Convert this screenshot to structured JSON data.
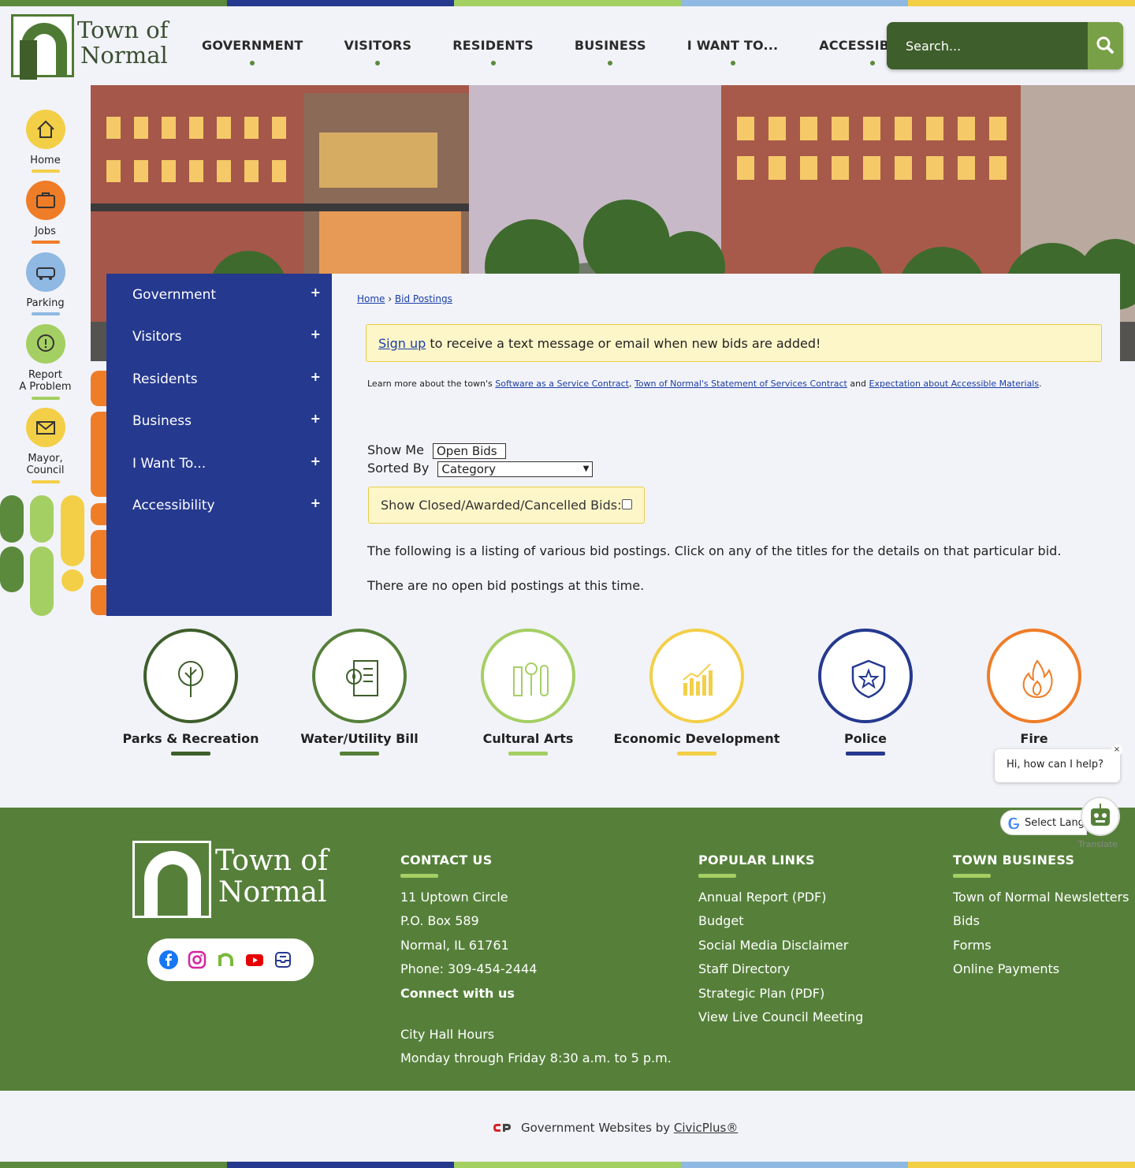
{
  "brand": {
    "line1": "Town of",
    "line2": "Normal",
    "stripe_colors": [
      "#5b8a3c",
      "#25398f",
      "#a4cf63",
      "#8fb8e2",
      "#f3cf48"
    ]
  },
  "nav": {
    "items": [
      "GOVERNMENT",
      "VISITORS",
      "RESIDENTS",
      "BUSINESS",
      "I WANT TO...",
      "ACCESSIBILITY"
    ]
  },
  "search": {
    "placeholder": "Search..."
  },
  "quicklinks": [
    {
      "label": "Home",
      "icon": "home-icon",
      "color": "#f3cf48"
    },
    {
      "label": "Jobs",
      "icon": "briefcase-icon",
      "color": "#ef7d28"
    },
    {
      "label": "Parking",
      "icon": "car-icon",
      "color": "#8fb8e2"
    },
    {
      "label": "Report\nA Problem",
      "icon": "alert-icon",
      "color": "#a4cf63"
    },
    {
      "label": "Mayor,\nCouncil",
      "icon": "mail-icon",
      "color": "#f3cf48"
    }
  ],
  "sidenav": {
    "items": [
      "Government",
      "Visitors",
      "Residents",
      "Business",
      "I Want To...",
      "Accessibility"
    ],
    "expand_symbol": "+"
  },
  "breadcrumb": {
    "home": "Home",
    "separator": "›",
    "current": "Bid Postings"
  },
  "notice": {
    "link": "Sign up",
    "text": " to receive a text message or email when new bids are added!"
  },
  "learn": {
    "prefix": "Learn more about the town's ",
    "link1": "Software as a Service Contract",
    "sep": ", ",
    "link2": "Town of Normal's Statement of Services Contract",
    "and": " and ",
    "link3": "Expectation about Accessible Materials",
    "end": "."
  },
  "filters": {
    "show_me_label": "Show Me",
    "show_me_value": "Open Bids",
    "sorted_by_label": "Sorted By",
    "sorted_by_value": "Category",
    "closed_label": "Show Closed/Awarded/Cancelled Bids:"
  },
  "content": {
    "intro": "The following is a listing of various bid postings. Click on any of the titles for the details on that particular bid.",
    "empty": "There are no open bid postings at this time."
  },
  "features": [
    {
      "label": "Parks & Recreation",
      "color": "#3e5e2b",
      "icon": "tree-icon"
    },
    {
      "label": "Water/Utility Bill",
      "color": "#56803a",
      "icon": "bill-icon"
    },
    {
      "label": "Cultural Arts",
      "color": "#a4cf63",
      "icon": "arts-icon"
    },
    {
      "label": "Economic Development",
      "color": "#f3cf48",
      "icon": "chart-icon"
    },
    {
      "label": "Police",
      "color": "#25398f",
      "icon": "badge-icon"
    },
    {
      "label": "Fire",
      "color": "#ef7d28",
      "icon": "flame-icon"
    }
  ],
  "chat": {
    "text": "Hi, how can I help?",
    "close": "×"
  },
  "translate": {
    "label": "Select Language",
    "powered": "Translate"
  },
  "footer": {
    "contact": {
      "heading": "CONTACT US",
      "lines": [
        "11 Uptown Circle",
        "P.O. Box 589",
        "Normal, IL 61761",
        "Phone: 309-454-2444"
      ],
      "connect": "Connect with us",
      "hours_title": "City Hall Hours",
      "hours": "Monday through Friday 8:30 a.m. to 5 p.m."
    },
    "popular": {
      "heading": "POPULAR LINKS",
      "links": [
        "Annual Report (PDF)",
        "Budget",
        "Social Media Disclaimer",
        "Staff Directory",
        "Strategic Plan (PDF)",
        "View Live Council Meeting"
      ]
    },
    "business": {
      "heading": "TOWN BUSINESS",
      "links": [
        "Town of Normal Newsletters",
        "Bids",
        "Forms",
        "Online Payments"
      ]
    },
    "social": [
      "facebook-icon",
      "instagram-icon",
      "normal-icon",
      "youtube-icon",
      "notify-icon"
    ]
  },
  "credit": {
    "prefix": "Government Websites by ",
    "link": "CivicPlus®"
  }
}
